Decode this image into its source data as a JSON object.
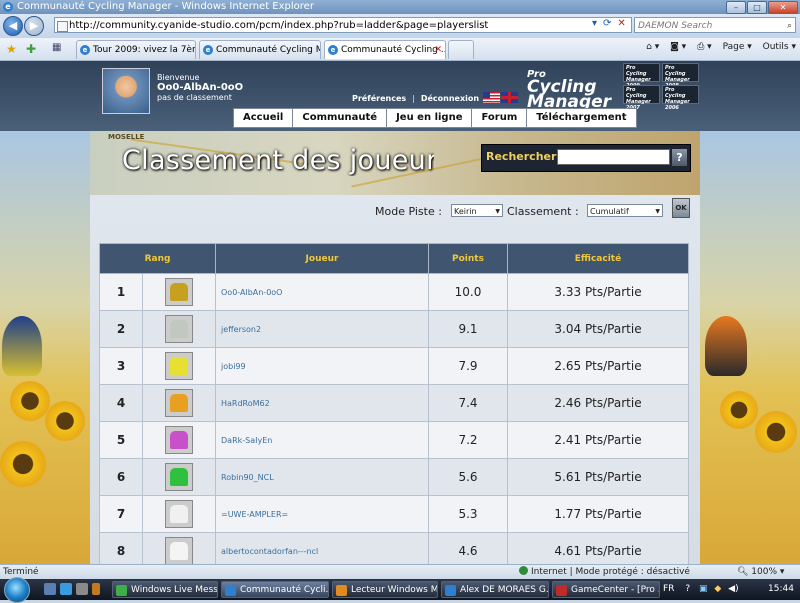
{
  "window": {
    "title": "Communauté Cycling Manager - Windows Internet Explorer"
  },
  "browser": {
    "url": "http://community.cyanide-studio.com/pcm/index.php?rub=ladder&page=playerslist",
    "search_placeholder": "DAEMON Search",
    "tabs": [
      {
        "label": "Tour 2009: vivez la 7ème ét..."
      },
      {
        "label": "Communauté Cycling Ma..."
      },
      {
        "label": "Communauté Cycling ..."
      }
    ],
    "commands": {
      "page": "Page ▾",
      "tools": "Outils ▾"
    }
  },
  "header": {
    "welcome": "Bienvenue",
    "username": "Oo0-AlbAn-0oO",
    "rank_status": "pas de classement",
    "preferences": "Préférences",
    "logout": "Déconnexion",
    "logo": {
      "line1": "Pro",
      "line2": "Cycling Manager",
      "year": "2009"
    },
    "mini_logos": [
      "Pro Cycling Manager 2009",
      "Pro Cycling Manager 2008",
      "Pro Cycling Manager 2007",
      "Pro Cycling Manager 2006"
    ]
  },
  "menu": [
    "Accueil",
    "Communauté",
    "Jeu en ligne",
    "Forum",
    "Téléchargement"
  ],
  "banner": {
    "title": "Classement des joueur",
    "map_label": "MOSELLE",
    "search_label": "Rechercher",
    "search_button": "?"
  },
  "filters": {
    "mode_label": "Mode Piste :",
    "mode_value": "Keirin",
    "ranking_label": "Classement :",
    "ranking_value": "Cumulatif",
    "ok_label": "OK"
  },
  "table": {
    "headers": {
      "rank": "Rang",
      "player": "Joueur",
      "points": "Points",
      "efficiency": "Efficacité"
    },
    "rows": [
      {
        "rank": "1",
        "player": "Oo0-AlbAn-0oO",
        "points": "10.0",
        "efficiency": "3.33 Pts/Partie",
        "jersey": "trophy-icon"
      },
      {
        "rank": "2",
        "player": "jefferson2",
        "points": "9.1",
        "efficiency": "3.04 Pts/Partie",
        "jersey": "jersey-icon"
      },
      {
        "rank": "3",
        "player": "jobi99",
        "points": "7.9",
        "efficiency": "2.65 Pts/Partie",
        "jersey": "jersey-icon"
      },
      {
        "rank": "4",
        "player": "HaRdRoM62",
        "points": "7.4",
        "efficiency": "2.46 Pts/Partie",
        "jersey": "jersey-icon"
      },
      {
        "rank": "5",
        "player": "DaRk-SaIyEn",
        "points": "7.2",
        "efficiency": "2.41 Pts/Partie",
        "jersey": "jersey-icon"
      },
      {
        "rank": "6",
        "player": "Robin90_NCL",
        "points": "5.6",
        "efficiency": "5.61 Pts/Partie",
        "jersey": "jersey-icon"
      },
      {
        "rank": "7",
        "player": "=UWE-AMPLER=",
        "points": "5.3",
        "efficiency": "1.77 Pts/Partie",
        "jersey": "jersey-icon"
      },
      {
        "rank": "8",
        "player": "albertocontadorfan---ncl",
        "points": "4.6",
        "efficiency": "4.61 Pts/Partie",
        "jersey": "jersey-icon"
      }
    ]
  },
  "jersey_colors": [
    "#c8a020",
    "#c0c8c0",
    "#e8e030",
    "#e8a020",
    "#c850c8",
    "#30c040",
    "#f0f0f0",
    "#f4f4f4"
  ],
  "statusbar": {
    "left": "Terminé",
    "zone": "Internet | Mode protégé : désactivé",
    "zoom": "100%"
  },
  "taskbar": {
    "tasks": [
      "Windows Live Mess...",
      "Communauté Cycli...",
      "Lecteur Windows M...",
      "Alex DE MORAES G...",
      "GameCenter - [Pro ..."
    ],
    "lang": "FR",
    "time": "15:44"
  }
}
